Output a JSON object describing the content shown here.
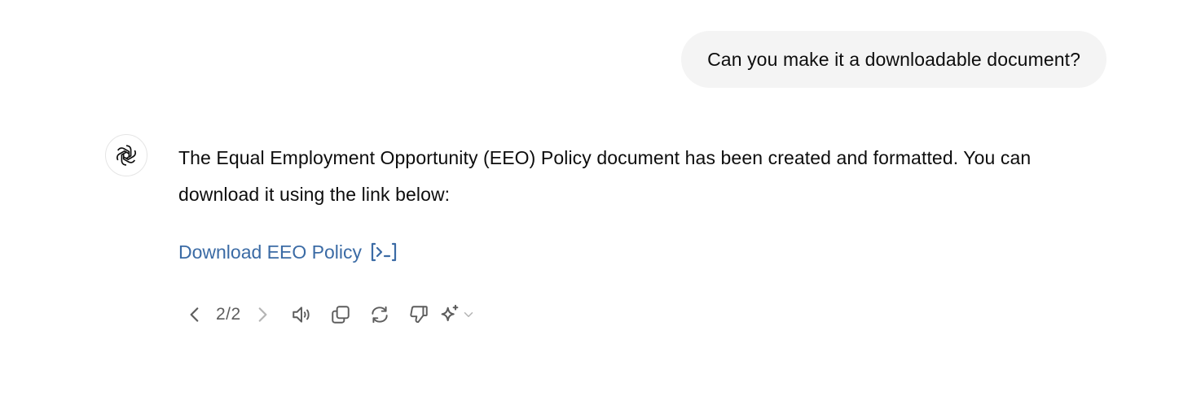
{
  "user_message": {
    "text": "Can you make it a downloadable document?"
  },
  "assistant_message": {
    "avatar_icon": "openai-logo-icon",
    "text": "The Equal Employment Opportunity (EEO) Policy document has been created and formatted. You can download it using the link below:",
    "download_link": {
      "label": "Download EEO Policy",
      "icon": "code-interpreter-icon",
      "color": "#3b6ba5"
    }
  },
  "action_bar": {
    "prev_icon": "chevron-left-icon",
    "page_count": "2/2",
    "next_icon": "chevron-right-icon",
    "actions": [
      {
        "icon": "read-aloud-icon"
      },
      {
        "icon": "copy-icon"
      },
      {
        "icon": "regenerate-icon"
      },
      {
        "icon": "thumbs-down-icon"
      },
      {
        "icon": "sparkle-icon"
      }
    ]
  },
  "colors": {
    "bubble_bg": "#f4f4f4",
    "text": "#0d0d0d",
    "icon": "#5d5d5d",
    "icon_disabled": "#b4b4b4"
  }
}
